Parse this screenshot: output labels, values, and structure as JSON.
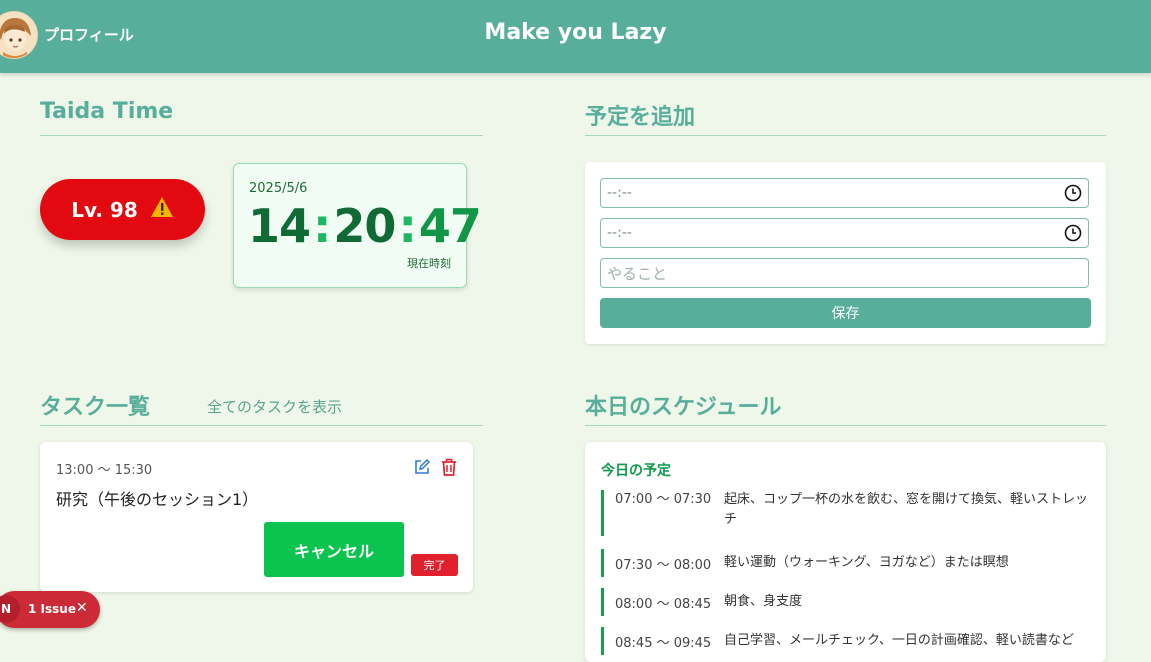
{
  "header": {
    "profile_label": "プロフィール",
    "app_title": "Make you Lazy"
  },
  "taida": {
    "title": "Taida Time",
    "level": "Lv. 98",
    "date": "2025/5/6",
    "hours": "14",
    "minutes": "20",
    "seconds": "47",
    "caption": "現在時刻"
  },
  "add_form": {
    "title": "予定を追加",
    "start_time": "--:--",
    "end_time": "--:--",
    "todo_placeholder": "やること",
    "save_label": "保存"
  },
  "tasks": {
    "title": "タスク一覧",
    "show_all": "全てのタスクを表示",
    "items": [
      {
        "time": "13:00 〜 15:30",
        "title": "研究（午後のセッション1）",
        "cancel_label": "キャンセル",
        "done_label": "完了"
      }
    ]
  },
  "schedule": {
    "title": "本日のスケジュール",
    "heading": "今日の予定",
    "items": [
      {
        "time": "07:00 〜 07:30",
        "text": "起床、コップ一杯の水を飲む、窓を開けて換気、軽いストレッチ"
      },
      {
        "time": "07:30 〜 08:00",
        "text": "軽い運動（ウォーキング、ヨガなど）または瞑想"
      },
      {
        "time": "08:00 〜 08:45",
        "text": "朝食、身支度"
      },
      {
        "time": "08:45 〜 09:45",
        "text": "自己学習、メールチェック、一日の計画確認、軽い読書など"
      }
    ]
  },
  "issue": {
    "badge": "N",
    "label": "1 Issue",
    "close": "✕"
  },
  "colors": {
    "primary": "#57ae9b",
    "background": "#eff7ea",
    "danger": "#e20a10",
    "success": "#0bc34f"
  }
}
